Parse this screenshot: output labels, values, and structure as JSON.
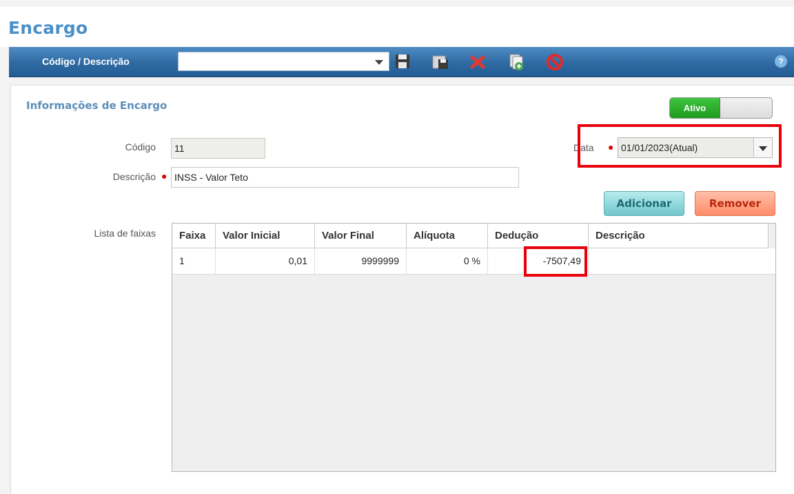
{
  "header": {
    "title": "Encargo"
  },
  "toolbar": {
    "label": "Código / Descrição",
    "combo_value": "",
    "icons": [
      "save-icon",
      "save-as-icon",
      "delete-icon",
      "copy-icon",
      "cancel-icon"
    ],
    "help": "?"
  },
  "form": {
    "section_title": "Informações de Encargo",
    "status_toggle": "Ativo",
    "codigo_label": "Código",
    "codigo_value": "11",
    "descricao_label": "Descrição",
    "descricao_value": "INSS - Valor Teto",
    "data_label": "Data",
    "data_value": "01/01/2023(Atual)",
    "add_button": "Adicionar",
    "remove_button": "Remover",
    "lista_label": "Lista de faixas"
  },
  "table": {
    "columns": [
      "Faixa",
      "Valor Inicial",
      "Valor Final",
      "Alíquota",
      "Dedução",
      "Descrição"
    ],
    "rows": [
      [
        "1",
        "0,01",
        "9999999",
        "0 %",
        "-7507,49",
        ""
      ]
    ]
  },
  "colors": {
    "accent": "#4a90c9",
    "toolbar": "#2f6aa3",
    "highlight": "#e8000b"
  }
}
